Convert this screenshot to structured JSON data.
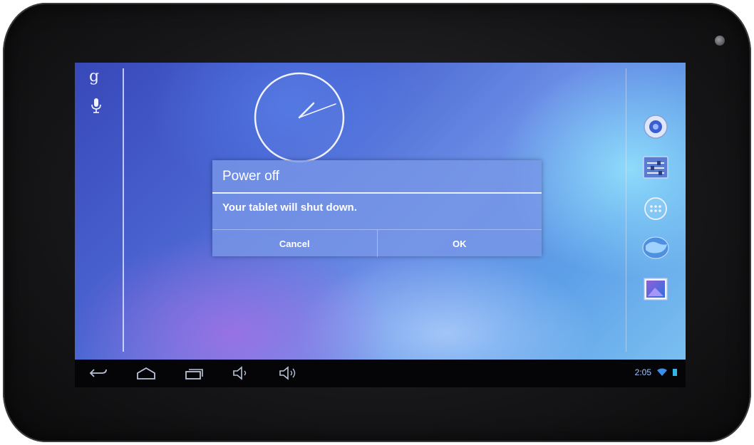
{
  "dialog": {
    "title": "Power off",
    "message": "Your tablet will shut down.",
    "cancel_label": "Cancel",
    "ok_label": "OK"
  },
  "search_bar": {
    "google_letter": "g",
    "voice_icon": "microphone-icon"
  },
  "clock": {
    "type": "analog",
    "hour_hand_minutes": 125,
    "minute_hand": 5
  },
  "dock": {
    "icons": [
      "music-icon",
      "settings-icon",
      "all-apps-icon",
      "browser-globe-icon",
      "gallery-icon"
    ]
  },
  "navbar": {
    "icons": [
      "back-icon",
      "home-icon",
      "recent-apps-icon",
      "volume-down-icon",
      "volume-up-icon"
    ]
  },
  "status_bar": {
    "time": "2:05",
    "icons": [
      "wifi-icon",
      "battery-icon"
    ]
  },
  "colors": {
    "accent": "#33b5e5",
    "dialog_bg": "#7896e6",
    "navbar_bg": "#050508"
  }
}
